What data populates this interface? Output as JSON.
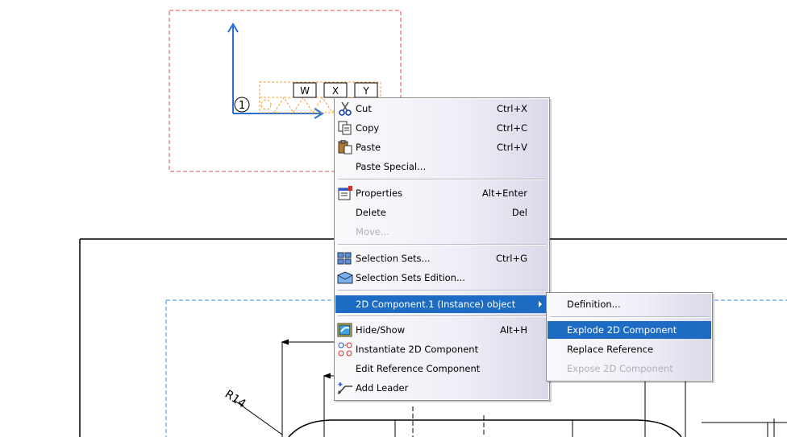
{
  "drawing": {
    "balloon_number": "1",
    "row_labels": [
      "W",
      "X",
      "Y"
    ],
    "radius_label": "R14"
  },
  "context_menu": {
    "items": [
      {
        "label": "Cut",
        "shortcut": "Ctrl+X",
        "icon": "scissors-icon"
      },
      {
        "label": "Copy",
        "shortcut": "Ctrl+C",
        "icon": "copy-icon"
      },
      {
        "label": "Paste",
        "shortcut": "Ctrl+V",
        "icon": "paste-icon"
      },
      {
        "label": "Paste Special...",
        "shortcut": ""
      },
      {
        "label": "Properties",
        "shortcut": "Alt+Enter",
        "icon": "properties-icon"
      },
      {
        "label": "Delete",
        "shortcut": "Del"
      },
      {
        "label": "Move...",
        "shortcut": "",
        "disabled": true
      },
      {
        "label": "Selection Sets...",
        "shortcut": "Ctrl+G",
        "icon": "selection-sets-icon"
      },
      {
        "label": "Selection Sets Edition...",
        "shortcut": "",
        "icon": "selection-sets-edition-icon"
      },
      {
        "label": "2D Component.1 (Instance) object",
        "shortcut": "",
        "submenu": true,
        "highlighted": true
      },
      {
        "label": "Hide/Show",
        "shortcut": "Alt+H",
        "icon": "hide-show-icon"
      },
      {
        "label": "Instantiate 2D Component",
        "shortcut": "",
        "icon": "instantiate-icon"
      },
      {
        "label": "Edit Reference Component",
        "shortcut": ""
      },
      {
        "label": "Add Leader",
        "shortcut": "",
        "icon": "add-leader-icon"
      }
    ]
  },
  "submenu": {
    "items": [
      {
        "label": "Definition..."
      },
      {
        "label": "Explode 2D Component",
        "highlighted": true
      },
      {
        "label": "Replace Reference"
      },
      {
        "label": "Expose 2D Component",
        "disabled": true
      }
    ]
  },
  "colors": {
    "highlight": "#1c6cc4",
    "axis_blue": "#2a6fd6",
    "selection_orange": "#f0a030",
    "frame_red": "#e04848",
    "frame_blue": "#4a8ae0"
  }
}
